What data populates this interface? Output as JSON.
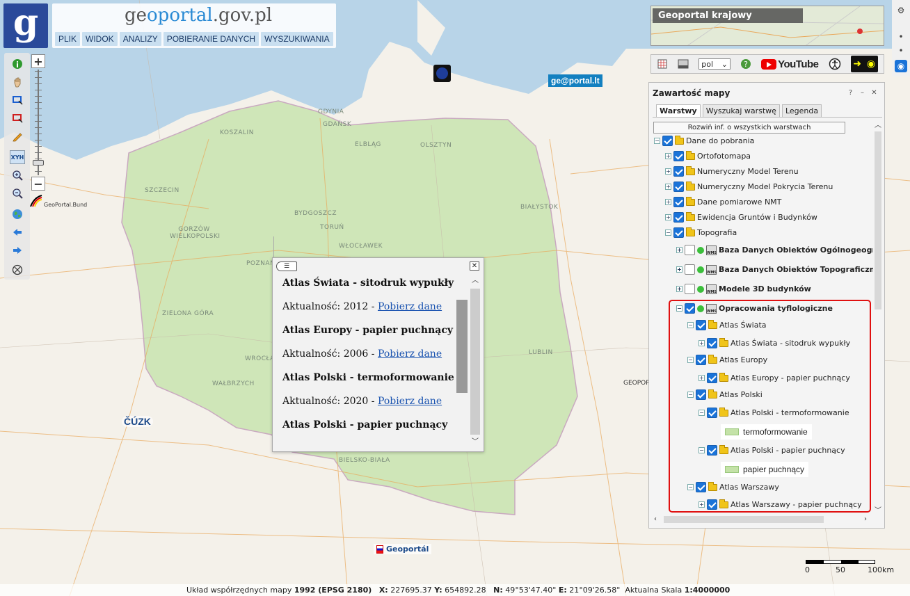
{
  "header": {
    "logo_letter": "g",
    "brand_part1": "ge",
    "brand_part2": "oportal",
    "brand_part3": ".gov.pl",
    "menu": [
      "PLIK",
      "WIDOK",
      "ANALIZY",
      "POBIERANIE DANYCH",
      "WYSZUKIWANIA"
    ]
  },
  "zoom": {
    "plus": "+",
    "minus": "−"
  },
  "left_tools": [
    "info-icon",
    "pan-icon",
    "select-rect-icon",
    "clear-select-icon",
    "pencil-icon",
    "xyh-icon",
    "zoom-in-icon",
    "zoom-out-icon",
    "globe-icon",
    "back-icon",
    "forward-icon",
    "measure-icon"
  ],
  "xyh_label": "XYH",
  "bund_label": "GeoPortal.Bund",
  "overview": {
    "title": "Geoportal krajowy"
  },
  "toolbar": {
    "lang": "pol",
    "youtube": "YouTube",
    "help": "?"
  },
  "neighbour_logos": {
    "lt": "ge@portal.lt",
    "cz": "ČÚZK",
    "sk": "Geoportál",
    "r": "GEOPOR"
  },
  "cities": [
    {
      "name": "GDYNIA"
    },
    {
      "name": "GDAŃSK"
    },
    {
      "name": "KOSZALIN"
    },
    {
      "name": "ELBLĄG"
    },
    {
      "name": "OLSZTYN"
    },
    {
      "name": "SZCZECIN"
    },
    {
      "name": "BYDGOSZCZ"
    },
    {
      "name": "TORUŃ"
    },
    {
      "name": "BIAŁYSTOK"
    },
    {
      "name": "GORZÓW WIELKOPOLSKI"
    },
    {
      "name": "WŁOCŁAWEK"
    },
    {
      "name": "POZNAŃ"
    },
    {
      "name": "ZIELONA GÓRA"
    },
    {
      "name": "WROCŁAW"
    },
    {
      "name": "LUBLIN"
    },
    {
      "name": "WAŁBRZYCH"
    },
    {
      "name": "BIELSKO-BIAŁA"
    }
  ],
  "popup": {
    "items": [
      {
        "title": "Atlas Świata - sitodruk wypukły",
        "prefix": "Aktualność: 2012 - ",
        "link": "Pobierz dane"
      },
      {
        "title": "Atlas Europy - papier puchnący",
        "prefix": "Aktualność: 2006 - ",
        "link": "Pobierz dane"
      },
      {
        "title": "Atlas Polski - termoformowanie",
        "prefix": "Aktualność: 2020 - ",
        "link": "Pobierz dane"
      },
      {
        "title": "Atlas Polski - papier puchnący"
      }
    ]
  },
  "panel": {
    "title": "Zawartość mapy",
    "tabs": [
      "Warstwy",
      "Wyszukaj warstwę",
      "Legenda"
    ],
    "expand_all": "Rozwiń inf. o wszystkich warstwach",
    "tree": [
      {
        "label": "Dane do pobrania"
      },
      {
        "label": "Ortofotomapa"
      },
      {
        "label": "Numeryczny Model Terenu"
      },
      {
        "label": "Numeryczny Model Pokrycia Terenu"
      },
      {
        "label": "Dane pomiarowe NMT"
      },
      {
        "label": "Ewidencja Gruntów i Budynków"
      },
      {
        "label": "Topografia"
      },
      {
        "label": "Baza Danych Obiektów Ogólnogeograficznych"
      },
      {
        "label": "Baza Danych Obiektów Topograficznych"
      },
      {
        "label": "Modele 3D budynków"
      },
      {
        "label": "Opracowania tyflologiczne"
      },
      {
        "label": "Atlas Świata"
      },
      {
        "label": "Atlas Świata - sitodruk wypukły"
      },
      {
        "label": "Atlas Europy"
      },
      {
        "label": "Atlas Europy - papier puchnący"
      },
      {
        "label": "Atlas Polski"
      },
      {
        "label": "Atlas Polski - termoformowanie"
      },
      {
        "label": "Atlas Polski - papier puchnący"
      },
      {
        "label": "Atlas Warszawy"
      },
      {
        "label": "Atlas Warszawy - papier puchnący"
      }
    ],
    "legend": [
      "termoformowanie",
      "papier puchnący"
    ]
  },
  "scale": {
    "l0": "0",
    "l1": "50",
    "l2": "100km"
  },
  "status": {
    "prefix": "Układ współrzędnych mapy ",
    "crs": "1992 (EPSG 2180)",
    "x_label": "X:",
    "x": "227695.37",
    "y_label": "Y:",
    "y": "654892.28",
    "n_label": "N:",
    "n": "49°53'47.40\"",
    "e_label": "E:",
    "e": "21°09'26.58\"",
    "scale_label": "Aktualna Skala",
    "scale": "1:4000000"
  },
  "colors": {
    "poland_fill": "#c9e4b0",
    "sea": "#b0d0e8",
    "highlight": "#e01010",
    "menu_bg": "#c9dff0"
  }
}
